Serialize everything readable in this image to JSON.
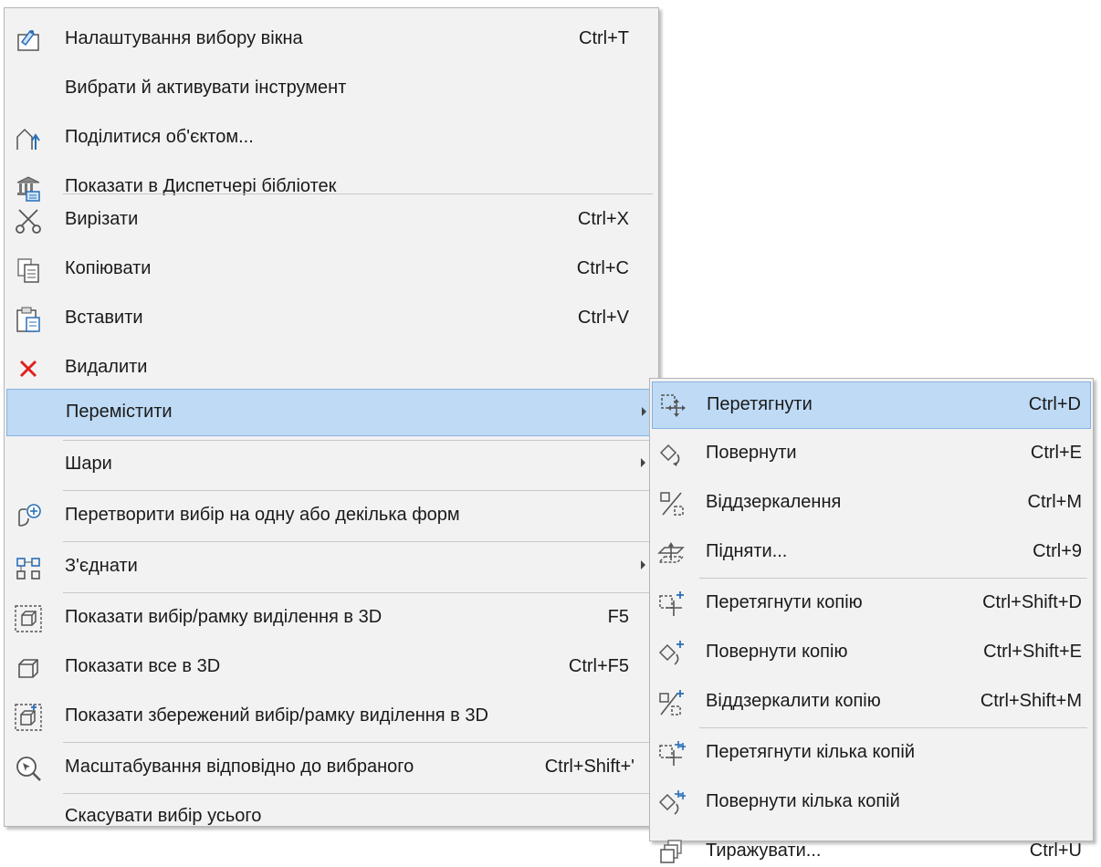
{
  "main_menu": {
    "items": [
      {
        "label": "Налаштування вибору вікна",
        "shortcut": "Ctrl+T",
        "icon": "selection-settings-icon"
      },
      {
        "label": "Вибрати й активувати інструмент",
        "shortcut": "",
        "icon": ""
      },
      {
        "label": "Поділитися об'єктом...",
        "shortcut": "",
        "icon": "share-object-icon"
      },
      {
        "label": "Показати в Диспетчері бібліотек",
        "shortcut": "",
        "icon": "library-manager-icon"
      },
      {
        "label": "Вирізати",
        "shortcut": "Ctrl+X",
        "icon": "cut-icon"
      },
      {
        "label": "Копіювати",
        "shortcut": "Ctrl+C",
        "icon": "copy-icon"
      },
      {
        "label": "Вставити",
        "shortcut": "Ctrl+V",
        "icon": "paste-icon"
      },
      {
        "label": "Видалити",
        "shortcut": "",
        "icon": "delete-icon"
      },
      {
        "label": "Перемістити",
        "shortcut": "",
        "icon": "",
        "has_submenu": true,
        "highlighted": true
      },
      {
        "label": "Шари",
        "shortcut": "",
        "icon": "",
        "has_submenu": true
      },
      {
        "label": "Перетворити вибір на одну або декілька форм",
        "shortcut": "",
        "icon": "convert-to-morph-icon"
      },
      {
        "label": "З'єднати",
        "shortcut": "",
        "icon": "connect-icon",
        "has_submenu": true
      },
      {
        "label": "Показати вибір/рамку виділення в 3D",
        "shortcut": "F5",
        "icon": "show-selection-3d-icon"
      },
      {
        "label": "Показати все в 3D",
        "shortcut": "Ctrl+F5",
        "icon": "show-all-3d-icon"
      },
      {
        "label": "Показати збережений вибір/рамку виділення в 3D",
        "shortcut": "",
        "icon": "show-saved-selection-3d-icon"
      },
      {
        "label": "Масштабування відповідно до вибраного",
        "shortcut": "Ctrl+Shift+'",
        "icon": "zoom-to-selection-icon"
      },
      {
        "label": "Скасувати вибір усього",
        "shortcut": "",
        "icon": ""
      }
    ]
  },
  "sub_menu": {
    "items": [
      {
        "label": "Перетягнути",
        "shortcut": "Ctrl+D",
        "icon": "drag-icon",
        "highlighted": true
      },
      {
        "label": "Повернути",
        "shortcut": "Ctrl+E",
        "icon": "rotate-icon"
      },
      {
        "label": "Віддзеркалення",
        "shortcut": "Ctrl+M",
        "icon": "mirror-icon"
      },
      {
        "label": "Підняти...",
        "shortcut": "Ctrl+9",
        "icon": "elevate-icon"
      },
      {
        "label": "Перетягнути копію",
        "shortcut": "Ctrl+Shift+D",
        "icon": "drag-copy-icon"
      },
      {
        "label": "Повернути копію",
        "shortcut": "Ctrl+Shift+E",
        "icon": "rotate-copy-icon"
      },
      {
        "label": "Віддзеркалити копію",
        "shortcut": "Ctrl+Shift+M",
        "icon": "mirror-copy-icon"
      },
      {
        "label": "Перетягнути кілька копій",
        "shortcut": "",
        "icon": "drag-multiple-copies-icon"
      },
      {
        "label": "Повернути кілька копій",
        "shortcut": "",
        "icon": "rotate-multiple-copies-icon"
      },
      {
        "label": "Тиражувати...",
        "shortcut": "Ctrl+U",
        "icon": "multiply-icon"
      }
    ]
  },
  "colors": {
    "menu_bg": "#f2f2f2",
    "highlight_bg": "#bfdaf5",
    "highlight_border": "#86b2e1",
    "delete_red": "#e02020",
    "icon_blue": "#2a6fb8"
  }
}
